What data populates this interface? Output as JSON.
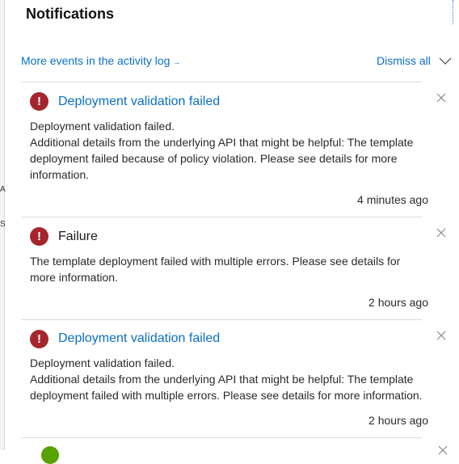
{
  "panel": {
    "title": "Notifications",
    "activity_link": "More events in the activity log",
    "activity_arrow": "→",
    "dismiss_all": "Dismiss all"
  },
  "left_strip": [
    "A",
    "S"
  ],
  "notifications": [
    {
      "title": "Deployment validation failed",
      "lines": [
        "Deployment validation failed.",
        "Additional details from the underlying API that might be helpful: The template",
        "deployment failed because of policy violation. Please see details for more",
        "information."
      ],
      "time": "4 minutes ago",
      "status": "error"
    },
    {
      "title": "Failure",
      "lines": [
        "The template deployment failed with multiple errors. Please see details for",
        "more information."
      ],
      "time": "2 hours ago",
      "status": "error"
    },
    {
      "title": "Deployment validation failed",
      "lines": [
        "Deployment validation failed.",
        "Additional details from the underlying API that might be helpful: The template",
        "deployment failed with multiple errors. Please see details for more information."
      ],
      "time": "2 hours ago",
      "status": "error"
    }
  ],
  "icons": {
    "error": "exclamation-icon",
    "close": "close-icon",
    "chevron": "chevron-down-icon",
    "success": "check-circle-icon"
  },
  "colors": {
    "link": "#0b6fc7",
    "error": "#a4262c",
    "success": "#57a300",
    "divider": "#dcdcdc"
  }
}
